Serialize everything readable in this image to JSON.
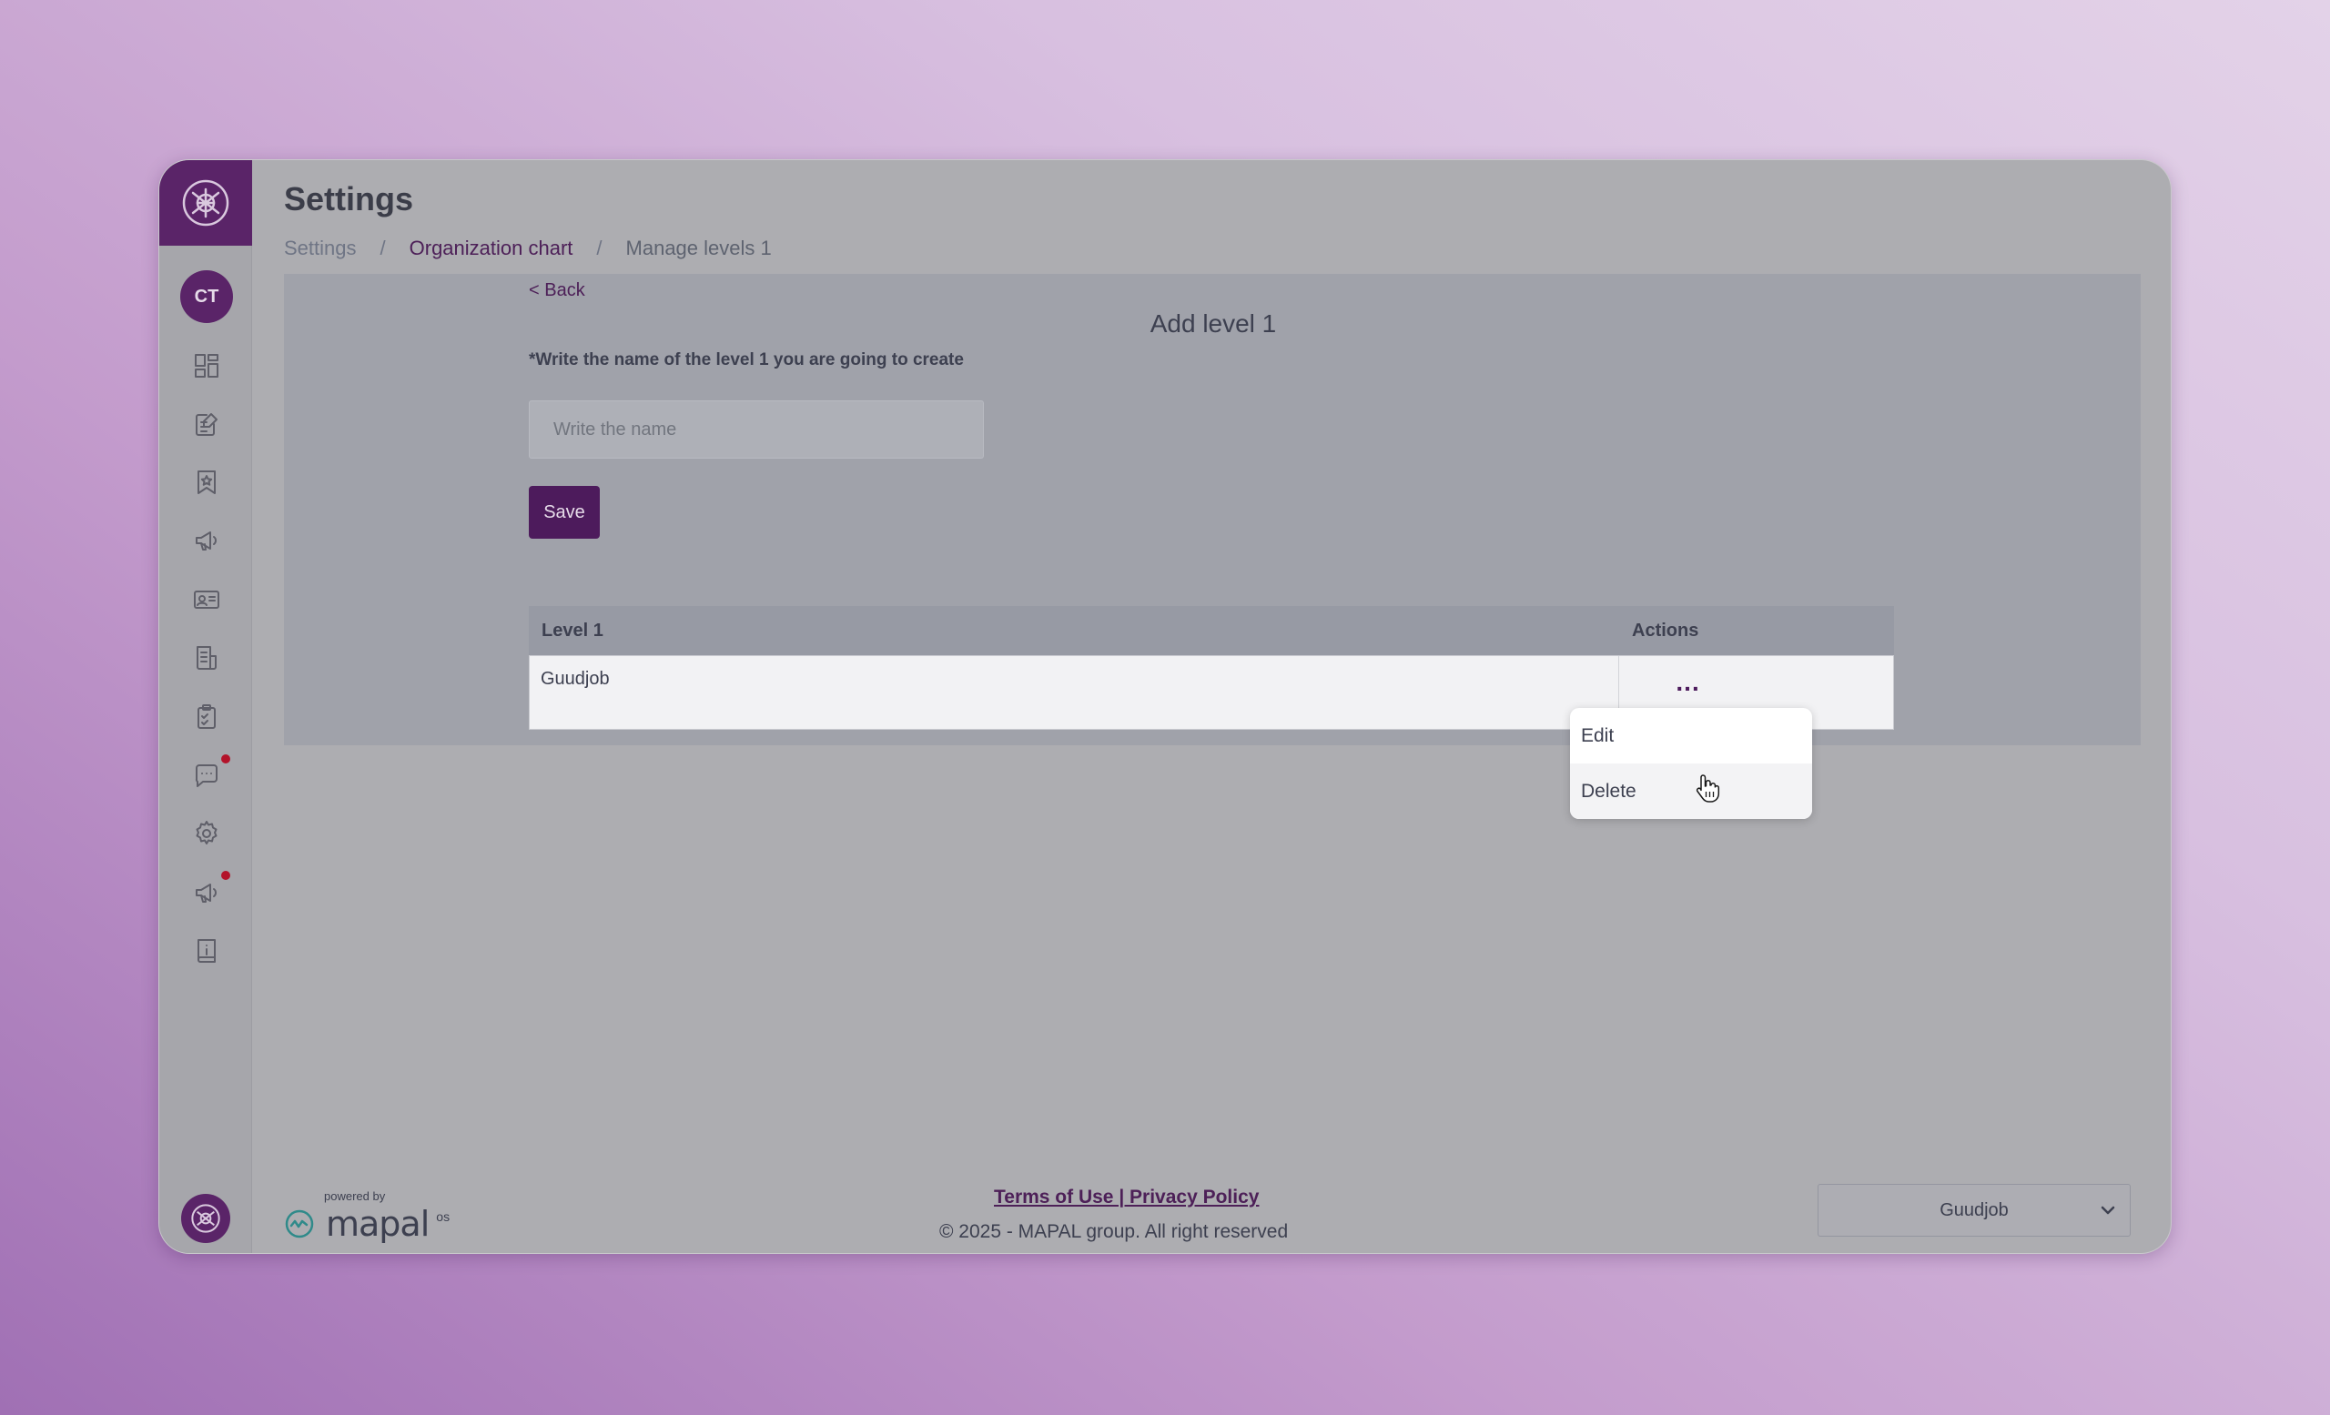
{
  "header": {
    "title": "Settings",
    "breadcrumb": [
      {
        "label": "Settings"
      },
      {
        "label": "Organization chart"
      },
      {
        "label": "Manage levels 1"
      }
    ],
    "separator": "/"
  },
  "sidebar": {
    "avatar_initials": "CT",
    "items": [
      {
        "icon": "dashboard-icon"
      },
      {
        "icon": "edit-document-icon"
      },
      {
        "icon": "bookmark-star-icon"
      },
      {
        "icon": "megaphone-icon"
      },
      {
        "icon": "id-card-icon"
      },
      {
        "icon": "document-icon"
      },
      {
        "icon": "clipboard-check-icon"
      },
      {
        "icon": "chat-icon",
        "badge": true
      },
      {
        "icon": "gear-icon"
      },
      {
        "icon": "announcement-icon",
        "badge": true
      },
      {
        "icon": "info-book-icon"
      }
    ]
  },
  "form": {
    "back_label": "< Back",
    "title": "Add level 1",
    "field_label": "*Write the name of the level 1 you are going to create",
    "input_placeholder": "Write the name",
    "input_value": "",
    "save_label": "Save"
  },
  "table": {
    "headers": [
      "Level 1",
      "Actions"
    ],
    "rows": [
      {
        "name": "Guudjob",
        "actions": "..."
      }
    ]
  },
  "menu": {
    "items": [
      "Edit",
      "Delete"
    ]
  },
  "footer": {
    "powered_by": "powered by",
    "brand": "mapal",
    "brand_suffix": "os",
    "links": "Terms of Use | Privacy Policy",
    "copyright": "© 2025 - MAPAL group. All right reserved",
    "org_select_value": "Guudjob"
  },
  "colors": {
    "brand_purple": "#5a2468",
    "badge_red": "#b3132a"
  }
}
